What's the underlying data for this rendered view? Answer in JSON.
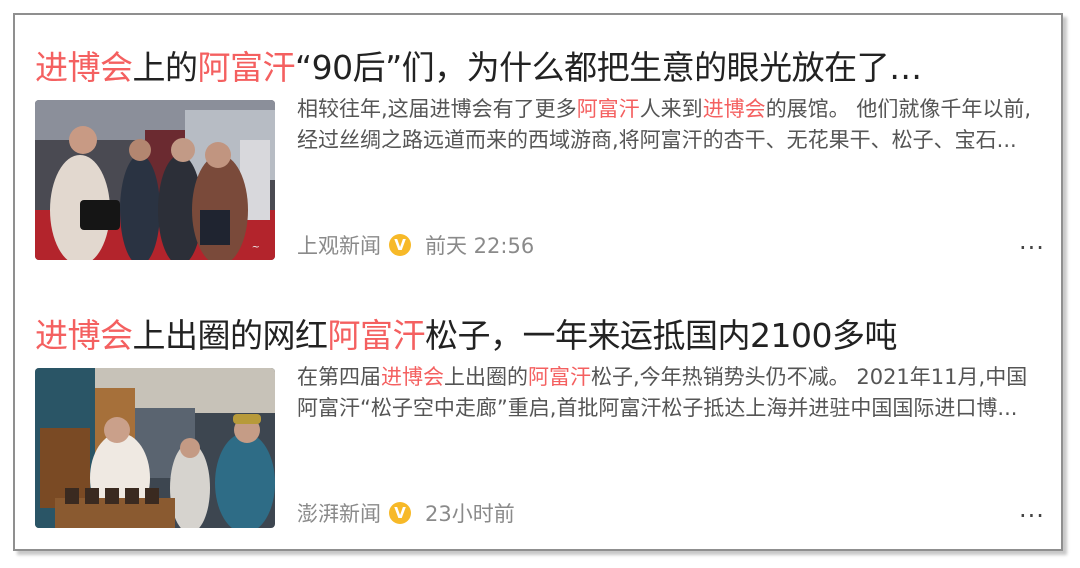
{
  "results": [
    {
      "title_parts": [
        {
          "text": "进博会",
          "hl": true
        },
        {
          "text": "上的",
          "hl": false
        },
        {
          "text": "阿富汗",
          "hl": true
        },
        {
          "text": "“90后”们，为什么都把生意的眼光放在了…",
          "hl": false
        }
      ],
      "summary_parts": [
        {
          "text": "相较往年,这届进博会有了更多",
          "hl": false
        },
        {
          "text": "阿富汗",
          "hl": true
        },
        {
          "text": "人来到",
          "hl": false
        },
        {
          "text": "进博会",
          "hl": true
        },
        {
          "text": "的展馆。 他们就像千年以前,经过丝绸之路远道而来的西域游商,将阿富汗的杏干、无花果干、松子、宝石...",
          "hl": false
        }
      ],
      "source": "上观新闻",
      "verified_mark": "V",
      "time": "前天 22:56",
      "more_label": "···",
      "thumb_icon": "exhibition-photo"
    },
    {
      "title_parts": [
        {
          "text": "进博会",
          "hl": true
        },
        {
          "text": "上出圈的网红",
          "hl": false
        },
        {
          "text": "阿富汗",
          "hl": true
        },
        {
          "text": "松子，一年来运抵国内2100多吨",
          "hl": false
        }
      ],
      "summary_parts": [
        {
          "text": "在第四届",
          "hl": false
        },
        {
          "text": "进博会",
          "hl": true
        },
        {
          "text": "上出圈的",
          "hl": false
        },
        {
          "text": "阿富汗",
          "hl": true
        },
        {
          "text": "松子,今年热销势头仍不减。 2021年11月,中国阿富汗“松子空中走廊”重启,首批阿富汗松子抵达上海并进驻中国国际进口博...",
          "hl": false
        }
      ],
      "source": "澎湃新闻",
      "verified_mark": "V",
      "time": "23小时前",
      "more_label": "···",
      "thumb_icon": "booth-photo"
    }
  ],
  "colors": {
    "highlight": "#f46060",
    "badge": "#f7b928",
    "meta": "#8a8a8a"
  }
}
